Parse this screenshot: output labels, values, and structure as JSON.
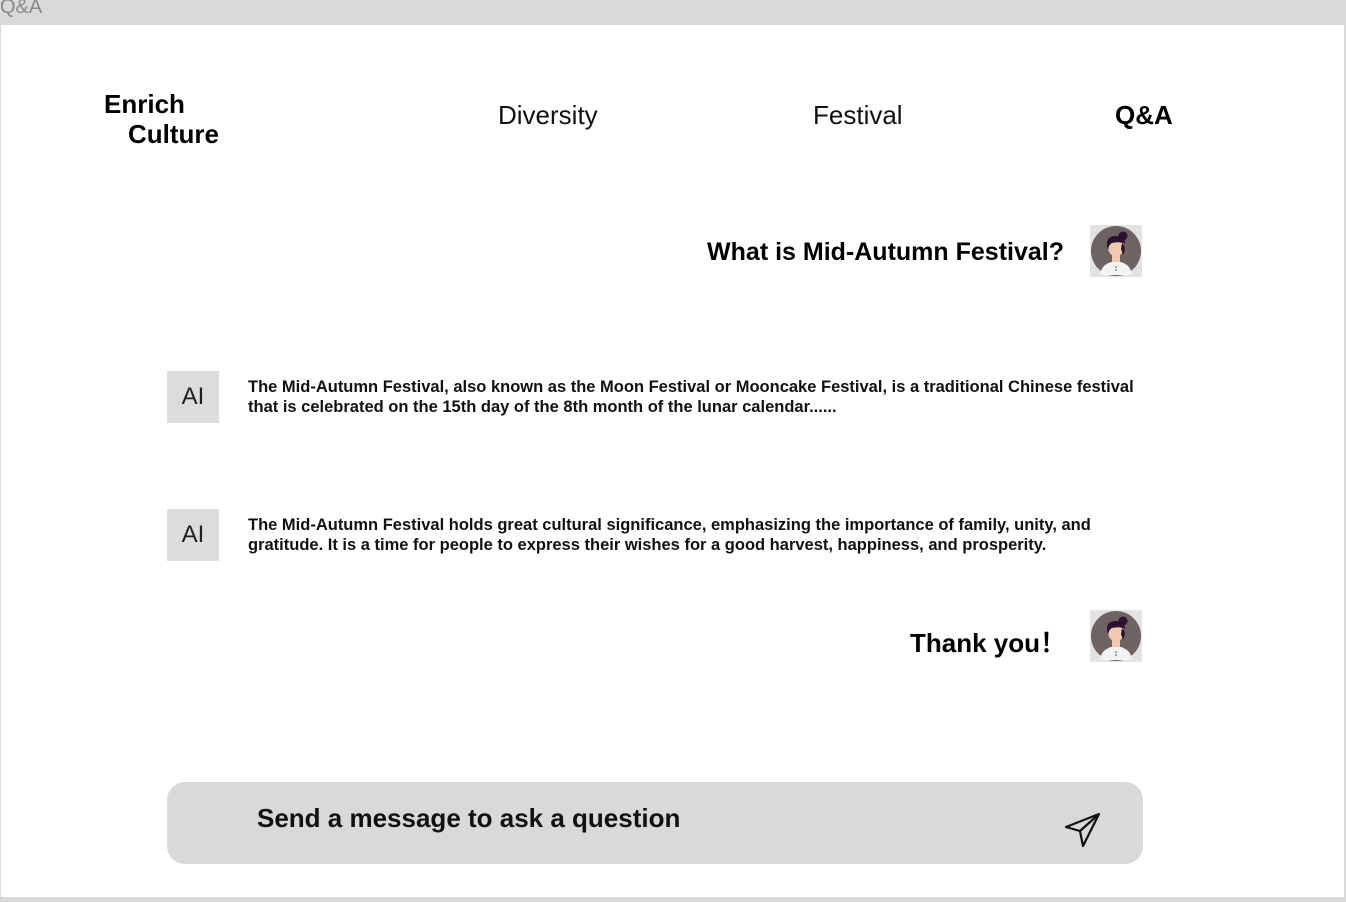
{
  "frame": {
    "label": "Q&A"
  },
  "brand": {
    "line1": "Enrich",
    "line2": "Culture"
  },
  "nav": {
    "items": [
      {
        "label": "Diversity"
      },
      {
        "label": "Festival"
      },
      {
        "label": "Q&A",
        "active": true
      }
    ]
  },
  "chat": {
    "messages": [
      {
        "role": "user",
        "text": "What is Mid-Autumn Festival?",
        "avatar_icon": "user-avatar-icon"
      },
      {
        "role": "ai",
        "badge": "AI",
        "text": "The Mid-Autumn Festival, also known as the Moon Festival or Mooncake Festival, is a traditional Chinese festival that is celebrated on the 15th day of the 8th month of the lunar calendar......"
      },
      {
        "role": "ai",
        "badge": "AI",
        "text": "The Mid-Autumn Festival holds great cultural significance, emphasizing the importance of family, unity, and gratitude. It is a time for people to express their wishes for a good harvest, happiness, and prosperity."
      },
      {
        "role": "user",
        "text": "Thank you！",
        "avatar_icon": "user-avatar-icon"
      }
    ]
  },
  "composer": {
    "placeholder": "Send a message to ask a question",
    "value": "",
    "send_icon": "send-icon"
  },
  "colors": {
    "background": "#d9d9d9",
    "panel": "#ffffff",
    "composer": "#d9d9d9",
    "badge": "#dcdcdc"
  }
}
